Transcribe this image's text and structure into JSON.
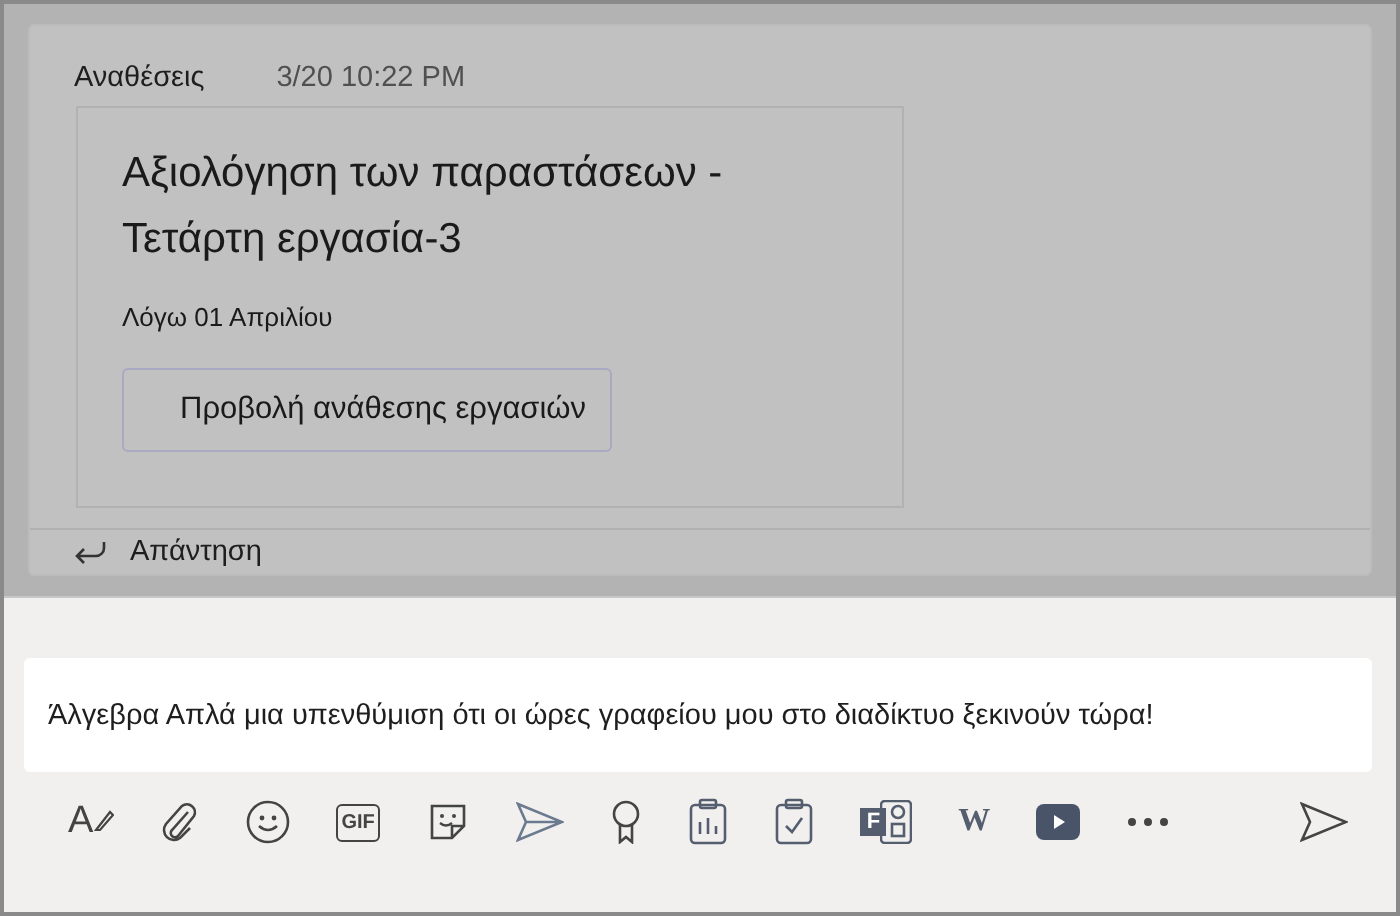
{
  "message": {
    "sender": "Αναθέσεις",
    "time": "3/20 10:22 PM",
    "card": {
      "title": "Αξιολόγηση των παραστάσεων - Τετάρτη εργασία-3",
      "due": "Λόγω 01 Απριλίου",
      "button": "Προβολή ανάθεσης εργασιών"
    },
    "reply": "Απάντηση"
  },
  "compose": {
    "value": "Άλγεβρα Απλά μια υπενθύμιση ότι οι ώρες γραφείου μου στο διαδίκτυο ξεκινούν τώρα!",
    "tools": [
      {
        "kind": "format",
        "glyph": "A"
      },
      {
        "kind": "attach"
      },
      {
        "kind": "emoji"
      },
      {
        "kind": "gif",
        "glyph": "GIF"
      },
      {
        "kind": "sticker"
      },
      {
        "kind": "plane"
      },
      {
        "kind": "praise"
      },
      {
        "kind": "poll"
      },
      {
        "kind": "approval"
      },
      {
        "kind": "forms",
        "glyph": "F"
      },
      {
        "kind": "wiki",
        "glyph": "W"
      },
      {
        "kind": "video"
      },
      {
        "kind": "more"
      }
    ]
  }
}
